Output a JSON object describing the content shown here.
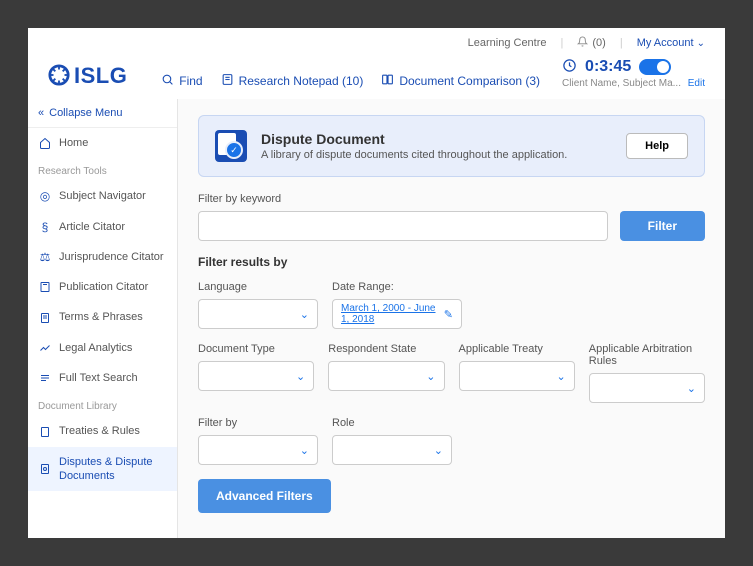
{
  "topbar": {
    "learning_centre": "Learning Centre",
    "notifications_count": "(0)",
    "my_account": "My Account"
  },
  "logo": {
    "text": "ISLG"
  },
  "nav": {
    "find": "Find",
    "notepad": "Research Notepad (10)",
    "comparison": "Document Comparison (3)"
  },
  "timer": {
    "value": "0:3:45",
    "client": "Client Name, Subject Ma...",
    "edit": "Edit"
  },
  "sidebar": {
    "collapse": "Collapse Menu",
    "home": "Home",
    "group1": "Research Tools",
    "subject_navigator": "Subject Navigator",
    "article_citator": "Article Citator",
    "jurisprudence_citator": "Jurisprudence Citator",
    "publication_citator": "Publication Citator",
    "terms_phrases": "Terms & Phrases",
    "legal_analytics": "Legal Analytics",
    "full_text_search": "Full Text Search",
    "group2": "Document Library",
    "treaties_rules": "Treaties & Rules",
    "disputes": "Disputes & Dispute Documents"
  },
  "banner": {
    "title": "Dispute Document",
    "subtitle": "A library of dispute documents cited throughout the application.",
    "help": "Help"
  },
  "filter": {
    "keyword_label": "Filter by keyword",
    "filter_btn": "Filter",
    "results_by": "Filter results by",
    "language": "Language",
    "date_range": "Date Range:",
    "date_value": "March 1, 2000 - June 1, 2018",
    "doc_type": "Document Type",
    "respondent_state": "Respondent State",
    "applicable_treaty": "Applicable Treaty",
    "arbitration_rules": "Applicable Arbitration Rules",
    "filter_by": "Filter by",
    "role": "Role",
    "advanced": "Advanced Filters"
  }
}
